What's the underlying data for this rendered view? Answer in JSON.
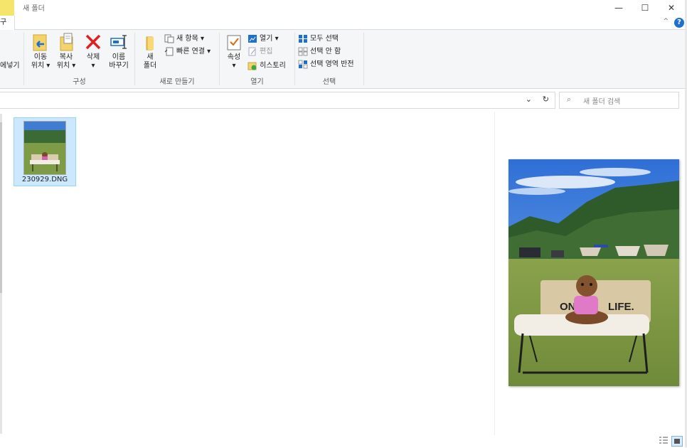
{
  "window": {
    "title": "새 폴더",
    "minimize_glyph": "—",
    "maximize_glyph": "☐",
    "close_glyph": "✕",
    "accent_color": "#f5e56b"
  },
  "tabs": {
    "active_partial": "구",
    "collapse_glyph": "^",
    "help_glyph": "?"
  },
  "ribbon": {
    "partial_label": "에넣기",
    "organize": {
      "label": "구성",
      "move_to": [
        "이동",
        "위치 ▾"
      ],
      "copy_to": [
        "복사",
        "위치 ▾"
      ],
      "delete": [
        "삭제",
        "▾"
      ],
      "rename": [
        "이름",
        "바꾸기"
      ]
    },
    "new": {
      "label": "새로 만들기",
      "new_folder": [
        "새",
        "폴더"
      ],
      "new_item": "새 항목 ▾",
      "easy_access": "빠른 연결 ▾"
    },
    "open": {
      "label": "열기",
      "properties": [
        "속성",
        "▾"
      ],
      "open": "열기 ▾",
      "edit": "편집",
      "history": "히스토리"
    },
    "select": {
      "label": "선택",
      "select_all": "모두 선택",
      "select_none": "선택 안 함",
      "invert": "선택 영역 반전"
    }
  },
  "address": {
    "dropdown_glyph": "⌄",
    "refresh_glyph": "↻"
  },
  "search": {
    "placeholder": "새 폴더 검색",
    "icon_glyph": "⌕"
  },
  "files": [
    {
      "name": "230929.DNG",
      "selected": true
    }
  ],
  "colors": {
    "selection_bg": "#cce8ff",
    "selection_border": "#99d1ff",
    "help_blue": "#1f6fd0"
  }
}
